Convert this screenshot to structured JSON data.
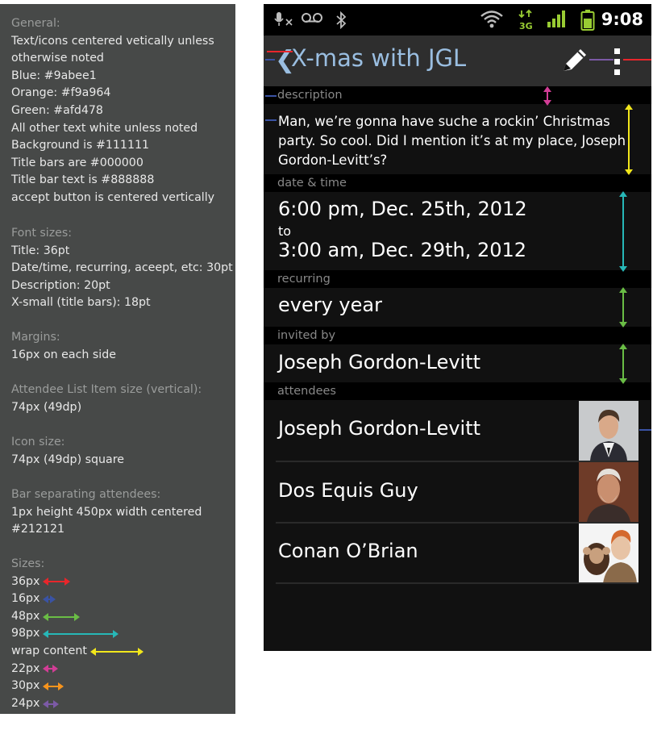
{
  "spec": {
    "general": {
      "heading": "General:",
      "lines": [
        "Text/icons centered vetically unless",
        "otherwise noted",
        "Blue: #9abee1",
        "Orange: #f9a964",
        "Green: #afd478",
        "All other text white unless noted",
        "Background is #111111",
        "Title bars are #000000",
        "Title bar text is #888888",
        "accept button is centered vertically"
      ]
    },
    "font_sizes": {
      "heading": "Font sizes:",
      "lines": [
        "Title: 36pt",
        "Date/time, recurring, aceept, etc: 30pt",
        "Description: 20pt",
        "X-small (title bars): 18pt"
      ]
    },
    "margins": {
      "heading": "Margins:",
      "lines": [
        "16px on each side"
      ]
    },
    "attendee_item": {
      "heading": "Attendee List Item size (vertical):",
      "lines": [
        "74px (49dp)"
      ]
    },
    "icon_size": {
      "heading": "Icon size:",
      "lines": [
        "74px (49dp) square"
      ]
    },
    "bar_sep": {
      "heading": "Bar separating attendees:",
      "lines": [
        "1px height 450px width centered",
        "#212121"
      ]
    },
    "sizes": {
      "heading": "Sizes:",
      "items": [
        {
          "label": "36px",
          "color": "#e8262b"
        },
        {
          "label": "16px",
          "color": "#3a53a4"
        },
        {
          "label": "48px",
          "color": "#6abd45"
        },
        {
          "label": "98px",
          "color": "#27b7b7"
        },
        {
          "label": "wrap content",
          "color": "#f2e71b"
        },
        {
          "label": "22px",
          "color": "#d23d96"
        },
        {
          "label": "30px",
          "color": "#f7941d"
        },
        {
          "label": "24px",
          "color": "#7c5aa6"
        }
      ]
    }
  },
  "phone": {
    "status": {
      "time": "9:08",
      "network": "3G"
    },
    "title": "X-mas with JGL",
    "colors": {
      "blue": "#9abee1",
      "background": "#111111",
      "titlebar": "#000000",
      "titlebar_text": "#888888"
    },
    "sections": {
      "description_label": "description",
      "description_lines": [
        "Man, we’re gonna have suche a rockin’ Christmas",
        "party. So cool. Did I mention it’s at my place, Joseph",
        "Gordon-Levitt’s?"
      ],
      "datetime_label": "date & time",
      "start": "6:00 pm, Dec. 25th, 2012",
      "to": "to",
      "end": "3:00 am, Dec. 29th, 2012",
      "recurring_label": "recurring",
      "recurring_value": "every year",
      "invited_label": "invited by",
      "invited_value": "Joseph Gordon-Levitt",
      "attendees_label": "attendees"
    },
    "attendees": [
      {
        "name": "Joseph Gordon-Levitt"
      },
      {
        "name": "Dos Equis Guy"
      },
      {
        "name": "Conan O’Brian"
      }
    ]
  }
}
